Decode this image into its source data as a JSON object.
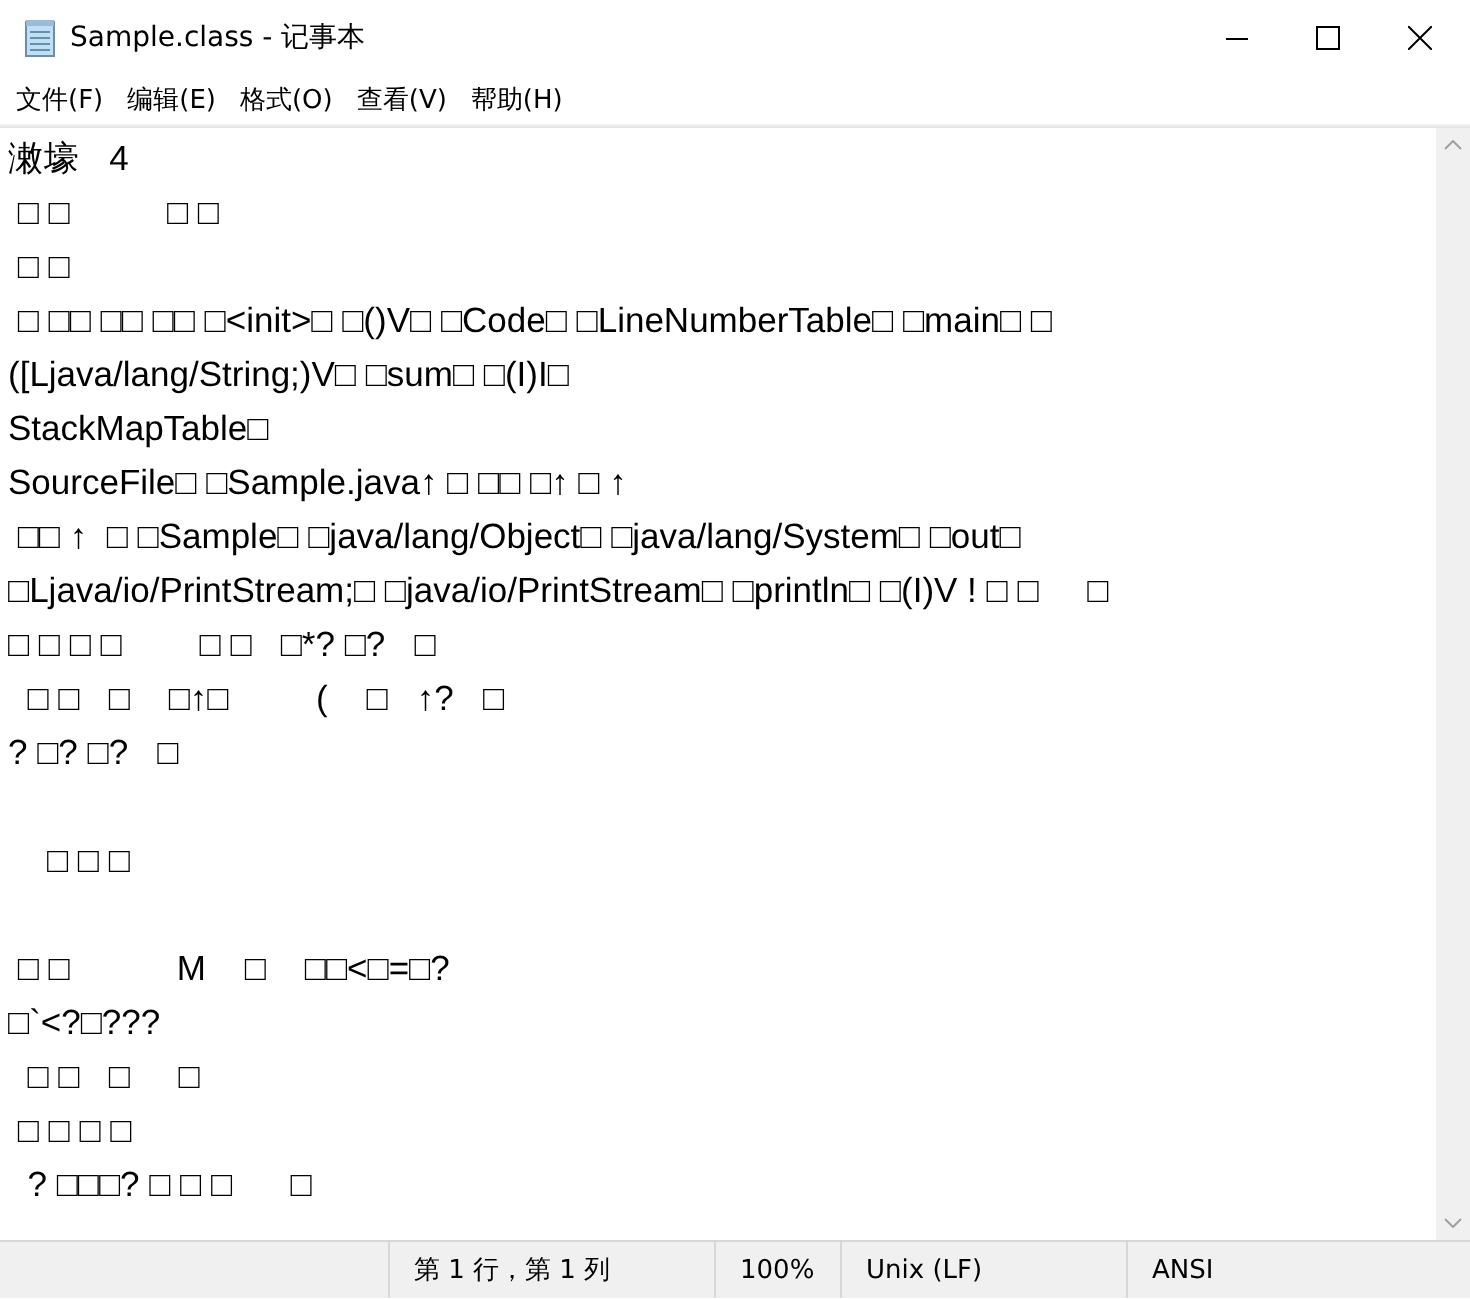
{
  "window": {
    "title": "Sample.class - 记事本"
  },
  "menu": [
    "文件(F)",
    "编辑(E)",
    "格式(O)",
    "查看(V)",
    "帮助(H)"
  ],
  "editor": {
    "lines": [
      {
        "kind": "text",
        "text": "潄壕   4"
      },
      {
        "kind": "text",
        "text": " □ □          □ □"
      },
      {
        "kind": "text",
        "text": " □ □"
      },
      {
        "kind": "text",
        "text": " □ □□ □□ □□ □<init>□ □()V□ □Code□ □LineNumberTable□ □main□ □"
      },
      {
        "kind": "text",
        "text": "([Ljava/lang/String;)V□ □sum□ □(I)I□"
      },
      {
        "kind": "text",
        "text": "StackMapTable□"
      },
      {
        "kind": "text",
        "text": "SourceFile□ □Sample.java↑ □ □□ □↑ □ ↑"
      },
      {
        "kind": "text",
        "text": " □□ ↑  □ □Sample□ □java/lang/Object□ □java/lang/System□ □out□"
      },
      {
        "kind": "text",
        "text": "□Ljava/io/PrintStream;□ □java/io/PrintStream□ □println□ □(I)V ! □ □     □"
      },
      {
        "kind": "text",
        "text": "□ □ □ □        □ □   □*? □?   □"
      },
      {
        "kind": "text",
        "text": "  □ □   □    □↑□         (    □   ↑?   □"
      },
      {
        "kind": "text",
        "text": "? □? □?   □"
      },
      {
        "kind": "blank"
      },
      {
        "kind": "text",
        "text": "    □ □ □"
      },
      {
        "kind": "blank"
      },
      {
        "kind": "text",
        "text": " □ □           M    □    □□<□=□?"
      },
      {
        "kind": "text",
        "text": "□`<?□???"
      },
      {
        "kind": "text",
        "text": "  □ □   □     □"
      },
      {
        "kind": "text",
        "text": " □ □ □ □"
      },
      {
        "kind": "text",
        "text": "  ? □□□? □ □ □      □"
      }
    ]
  },
  "status_bar": {
    "position": "第 1 行，第 1 列",
    "zoom": "100%",
    "line_ending": "Unix (LF)",
    "encoding": "ANSI"
  }
}
